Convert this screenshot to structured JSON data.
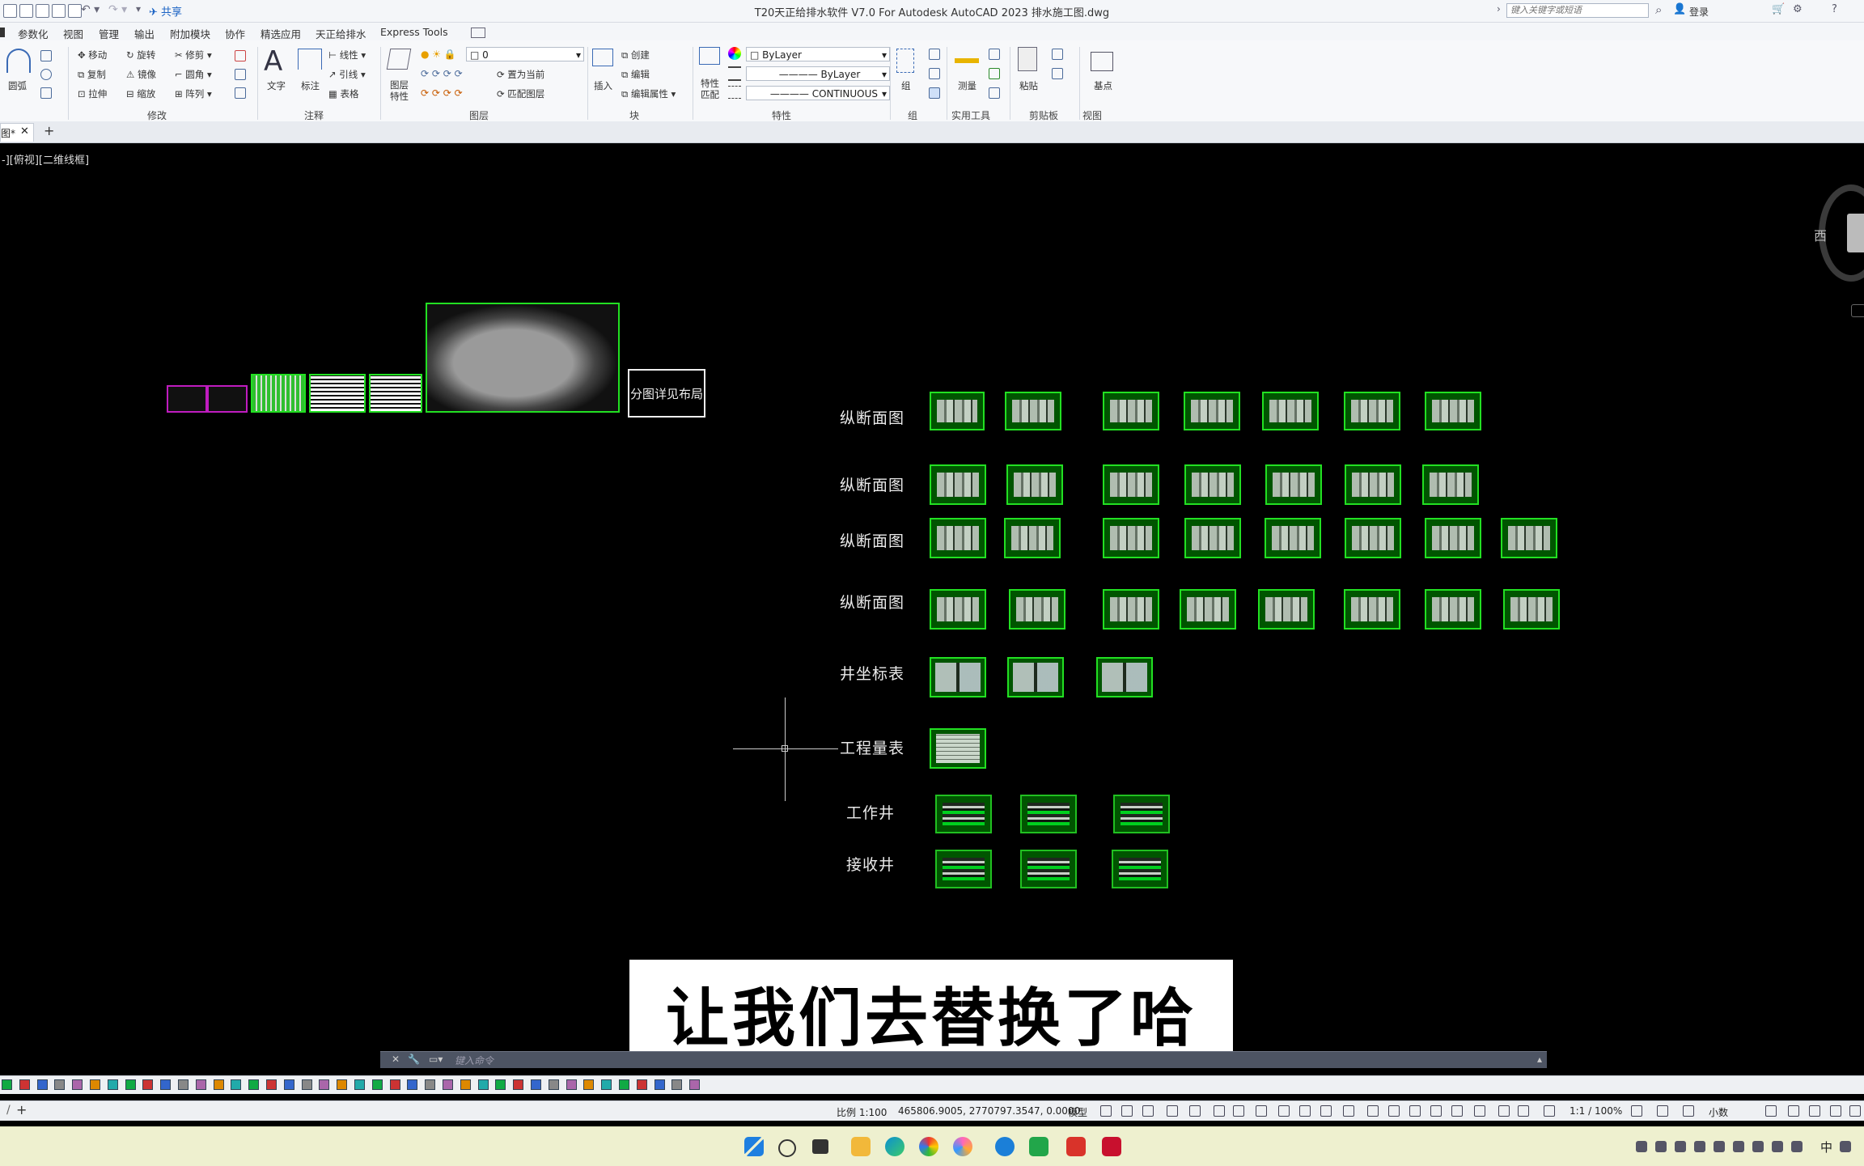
{
  "window": {
    "title": "T20天正给排水软件 V7.0 For Autodesk AutoCAD 2023    排水施工图.dwg"
  },
  "titlebar": {
    "share": "共享",
    "search_placeholder": "键入关键字或短语",
    "login": "登录"
  },
  "menu": [
    "参数化",
    "视图",
    "管理",
    "输出",
    "附加模块",
    "协作",
    "精选应用",
    "天正给排水",
    "Express Tools"
  ],
  "ribbon": {
    "draw": {
      "circle": "圆弧"
    },
    "modify": {
      "move": "移动",
      "rotate": "旋转",
      "trim": "修剪",
      "copy": "复制",
      "mirror": "镜像",
      "fillet": "圆角",
      "stretch": "拉伸",
      "scale": "缩放",
      "array": "阵列",
      "panel": "修改"
    },
    "annotation": {
      "text": "文字",
      "dim": "标注",
      "linear": "线性",
      "leader": "引线",
      "table": "表格",
      "panel": "注释"
    },
    "layers": {
      "props": "图层\n特性",
      "current_layer": "0",
      "set_current": "置为当前",
      "match": "匹配图层",
      "panel": "图层"
    },
    "block": {
      "insert": "插入",
      "create": "创建",
      "edit": "编辑",
      "edit_attr": "编辑属性",
      "panel": "块"
    },
    "properties": {
      "match": "特性\n匹配",
      "color": "ByLayer",
      "lineweight": "ByLayer",
      "linetype": "CONTINUOUS",
      "panel": "特性"
    },
    "groups": {
      "group": "组",
      "panel": "组"
    },
    "utilities": {
      "measure": "测量",
      "panel": "实用工具"
    },
    "clipboard": {
      "paste": "粘贴",
      "panel": "剪贴板"
    },
    "view": {
      "base": "基点",
      "panel": "视图"
    }
  },
  "tabs": {
    "doc": "图*"
  },
  "viewport": {
    "label": "-][俯视][二维线框]",
    "compass": "西"
  },
  "drawing": {
    "layout_box": "分图详见布局",
    "rows": [
      "纵断面图",
      "纵断面图",
      "纵断面图",
      "纵断面图",
      "井坐标表",
      "工程量表",
      "工作井",
      "接收井"
    ]
  },
  "command": {
    "placeholder": "键入命令"
  },
  "statusbar": {
    "scale": "比例 1:100",
    "coords": "465806.9005, 2770797.3547, 0.0000",
    "model": "模型",
    "zoom": "1:1 / 100%",
    "units": "小数"
  },
  "subtitle": "让我们去替换了哈",
  "taskbar": {
    "ime": "中"
  }
}
